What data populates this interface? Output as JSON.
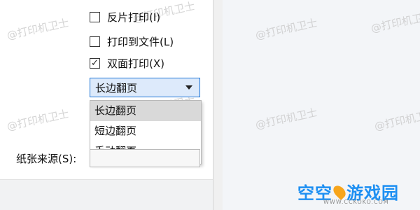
{
  "print_options": {
    "reverse_print": {
      "label": "反片打印(I)",
      "checked": false
    },
    "print_to_file": {
      "label": "打印到文件(L)",
      "checked": false
    },
    "duplex_print": {
      "label": "双面打印(X)",
      "checked": true,
      "checkmark": "✓"
    }
  },
  "duplex_mode": {
    "selected": "长边翻页",
    "options": [
      "长边翻页",
      "短边翻页",
      "手动翻页"
    ],
    "highlighted_index": 0
  },
  "paper_source": {
    "label": "纸张来源(S):"
  },
  "watermark_text": "@打印机卫士",
  "brand": {
    "name_part1": "空空",
    "name_part2": "游戏园",
    "url": "WWW.CCKOKO.COM",
    "color": "#1d8ff2",
    "logo_color": "#f7a51c"
  }
}
